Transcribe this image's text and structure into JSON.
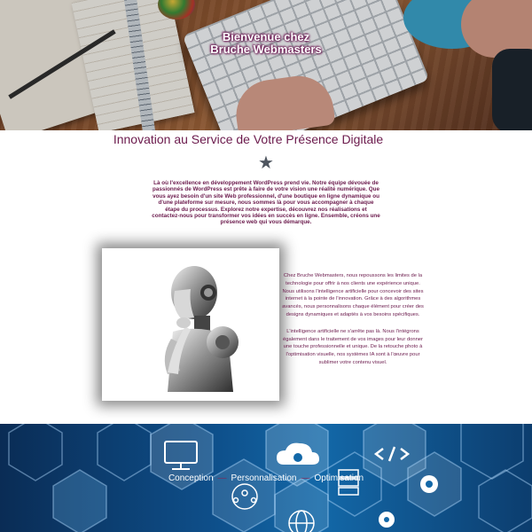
{
  "hero": {
    "title_line1": "Bienvenue chez",
    "title_line2": "Bruche Webmasters"
  },
  "intro": {
    "heading": "Innovation au Service de Votre Présence Digitale",
    "star_icon": "star-icon",
    "text": "Là où l'excellence en développement WordPress prend vie. Notre équipe dévouée de passionnés de WordPress est prête à faire de votre vision une réalité numérique. Que vous ayez besoin d'un site Web professionnel, d'une boutique en ligne dynamique ou d'une plateforme sur mesure, nous sommes là pour vous accompagner à chaque étape du processus. Explorez notre expertise, découvrez nos réalisations et contactez-nous pour transformer vos idées en succès en ligne. Ensemble, créons une présence web qui vous démarque."
  },
  "ai_section": {
    "paragraph1": "Chez Bruche Webmasters, nous repoussons les limites de la technologie pour offrir à nos clients une expérience unique. Nous utilisons l'intelligence artificielle pour concevoir des sites internet à la pointe de l'innovation. Grâce à des algorithmes avancés, nous personnalisons chaque élément pour créer des designs dynamiques et adaptés à vos besoins spécifiques.",
    "paragraph2": "L'intelligence artificielle ne s'arrête pas là. Nous l'intégrons également dans le traitement de vos images pour leur donner une touche professionnelle et unique. De la retouche photo à l'optimisation visuelle, nos systèmes IA sont à l'œuvre pour sublimer votre contenu visuel."
  },
  "services": {
    "items": [
      "Conception",
      "Personnalisation",
      "Optimisation"
    ],
    "separator": "—"
  },
  "colors": {
    "brand_purple": "#6b1a4c",
    "tech_blue": "#0e4f8a"
  }
}
